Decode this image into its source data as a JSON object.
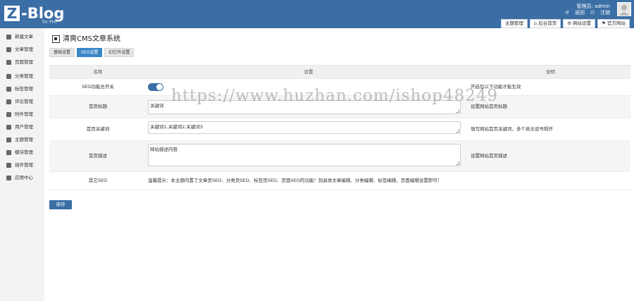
{
  "header": {
    "logo_mark": "Z",
    "logo_text": "-Blog",
    "logo_sub": "for PHP",
    "user_label": "管理员: admin",
    "links": [
      "返回",
      "注销"
    ]
  },
  "top_nav": [
    "主题管理",
    "后台首页",
    "网站设置",
    "官方网站"
  ],
  "sidebar": {
    "items": [
      {
        "label": "新建文章",
        "icon": "edit-icon"
      },
      {
        "label": "文章管理",
        "icon": "list-icon"
      },
      {
        "label": "页面管理",
        "icon": "page-icon"
      },
      {
        "label": "分类管理",
        "icon": "folder-icon"
      },
      {
        "label": "标签管理",
        "icon": "tag-icon"
      },
      {
        "label": "评论管理",
        "icon": "comment-icon"
      },
      {
        "label": "附件管理",
        "icon": "attachment-icon"
      },
      {
        "label": "用户管理",
        "icon": "user-icon"
      },
      {
        "label": "主题管理",
        "icon": "theme-icon"
      },
      {
        "label": "模块管理",
        "icon": "module-icon"
      },
      {
        "label": "插件管理",
        "icon": "plugin-icon"
      },
      {
        "label": "应用中心",
        "icon": "app-icon"
      }
    ]
  },
  "page": {
    "title": "清爽CMS文章系统",
    "tabs": [
      "基础设置",
      "SEO设置",
      "幻灯片设置"
    ],
    "active_tab": 1
  },
  "table": {
    "headers": [
      "名称",
      "设置",
      "说明"
    ],
    "rows": [
      {
        "name": "SEO功能总开关",
        "value": "",
        "desc": "开启后以下功能才能生效"
      },
      {
        "name": "首页标题",
        "value": "关键词",
        "desc": "设置网站首页标题"
      },
      {
        "name": "首页关键词",
        "value": "关键词1,关键词2,关键词3",
        "desc": "填写网站首页关键词，多个英文逗号隔开"
      },
      {
        "name": "首页描述",
        "value": "网站描述内容",
        "desc": "设置网站首页描述"
      },
      {
        "name": "其它SEO",
        "value": "温馨提示：本主题内置了文章页SEO、分类页SEO、标签页SEO、页面SEO的功能！到具体文章编辑、分类编辑、标签编辑、页面编辑设置即可！",
        "desc": ""
      }
    ]
  },
  "save_label": "保存",
  "watermark": "https://www.huzhan.com/ishop48249"
}
